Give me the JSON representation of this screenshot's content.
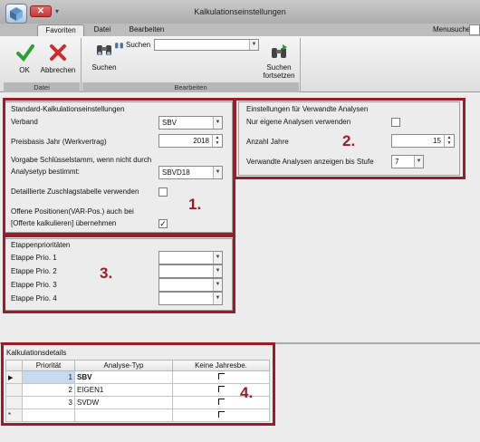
{
  "window": {
    "title": "Kalkulationseinstellungen",
    "close_glyph": "✕",
    "quick_access_glyph": "▾"
  },
  "tabs": [
    {
      "label": "Favoriten"
    },
    {
      "label": "Datei"
    },
    {
      "label": "Bearbeiten"
    }
  ],
  "menusuche": {
    "label": "Menusuche"
  },
  "ribbon": {
    "ok_label": "OK",
    "cancel_label": "Abbrechen",
    "group_datei": "Datei",
    "search_small_label": "Suchen",
    "search_value": "",
    "search_label": "Suchen",
    "search_continue_label": "Suchen\nfortsetzen",
    "group_bearbeiten": "Bearbeiten"
  },
  "standard": {
    "title": "Standard-Kalkulationseinstellungen",
    "verband_label": "Verband",
    "verband_value": "SBV",
    "preisbasis_label": "Preisbasis Jahr (Werkvertrag)",
    "preisbasis_value": "2018",
    "vorgabe_label_1": "Vorgabe Schlüsselstamm, wenn nicht durch",
    "vorgabe_label_2": "Analysetyp bestimmt:",
    "vorgabe_value": "SBVD18",
    "detail_label": "Detaillierte Zuschlagstabelle verwenden",
    "detail_checked": false,
    "offene_label_1": "Offene Positionen(VAR-Pos.) auch bei",
    "offene_label_2": "[Offerte kalkulieren] übernehmen",
    "offene_checked": true,
    "marker": "1."
  },
  "verwandte": {
    "title": "Einstellungen für Verwandte Analysen",
    "nur_label": "Nur eigene Analysen verwenden",
    "nur_checked": false,
    "anzahl_label": "Anzahl Jahre",
    "anzahl_value": "15",
    "stufe_label": "Verwandte Analysen anzeigen bis Stufe",
    "stufe_value": "7",
    "marker": "2."
  },
  "etappen": {
    "title": "Etappenprioritäten",
    "items": [
      {
        "label": "Etappe Prio. 1",
        "value": ""
      },
      {
        "label": "Etappe Prio. 2",
        "value": ""
      },
      {
        "label": "Etappe Prio. 3",
        "value": ""
      },
      {
        "label": "Etappe Prio. 4",
        "value": ""
      }
    ],
    "marker": "3."
  },
  "details": {
    "title": "Kalkulationsdetails",
    "columns": [
      "Priorität",
      "Analyse-Typ",
      "Keine Jahresbe."
    ],
    "rows": [
      {
        "indicator": "▶",
        "prio": "1",
        "typ": "SBV",
        "keine": false
      },
      {
        "indicator": "",
        "prio": "2",
        "typ": "EIGEN1",
        "keine": false
      },
      {
        "indicator": "",
        "prio": "3",
        "typ": "SVDW",
        "keine": false
      },
      {
        "indicator": "*",
        "prio": "",
        "typ": "",
        "keine": false
      }
    ],
    "marker": "4."
  },
  "colors": {
    "accent_frame": "#9d1b25",
    "selected_cell": "#c7daf0"
  },
  "icons": [
    "app-logo-icon",
    "checkmark-icon",
    "cross-icon",
    "binoculars-icon",
    "binoculars-search-icon",
    "binoculars-continue-icon",
    "chevron-down-icon"
  ]
}
